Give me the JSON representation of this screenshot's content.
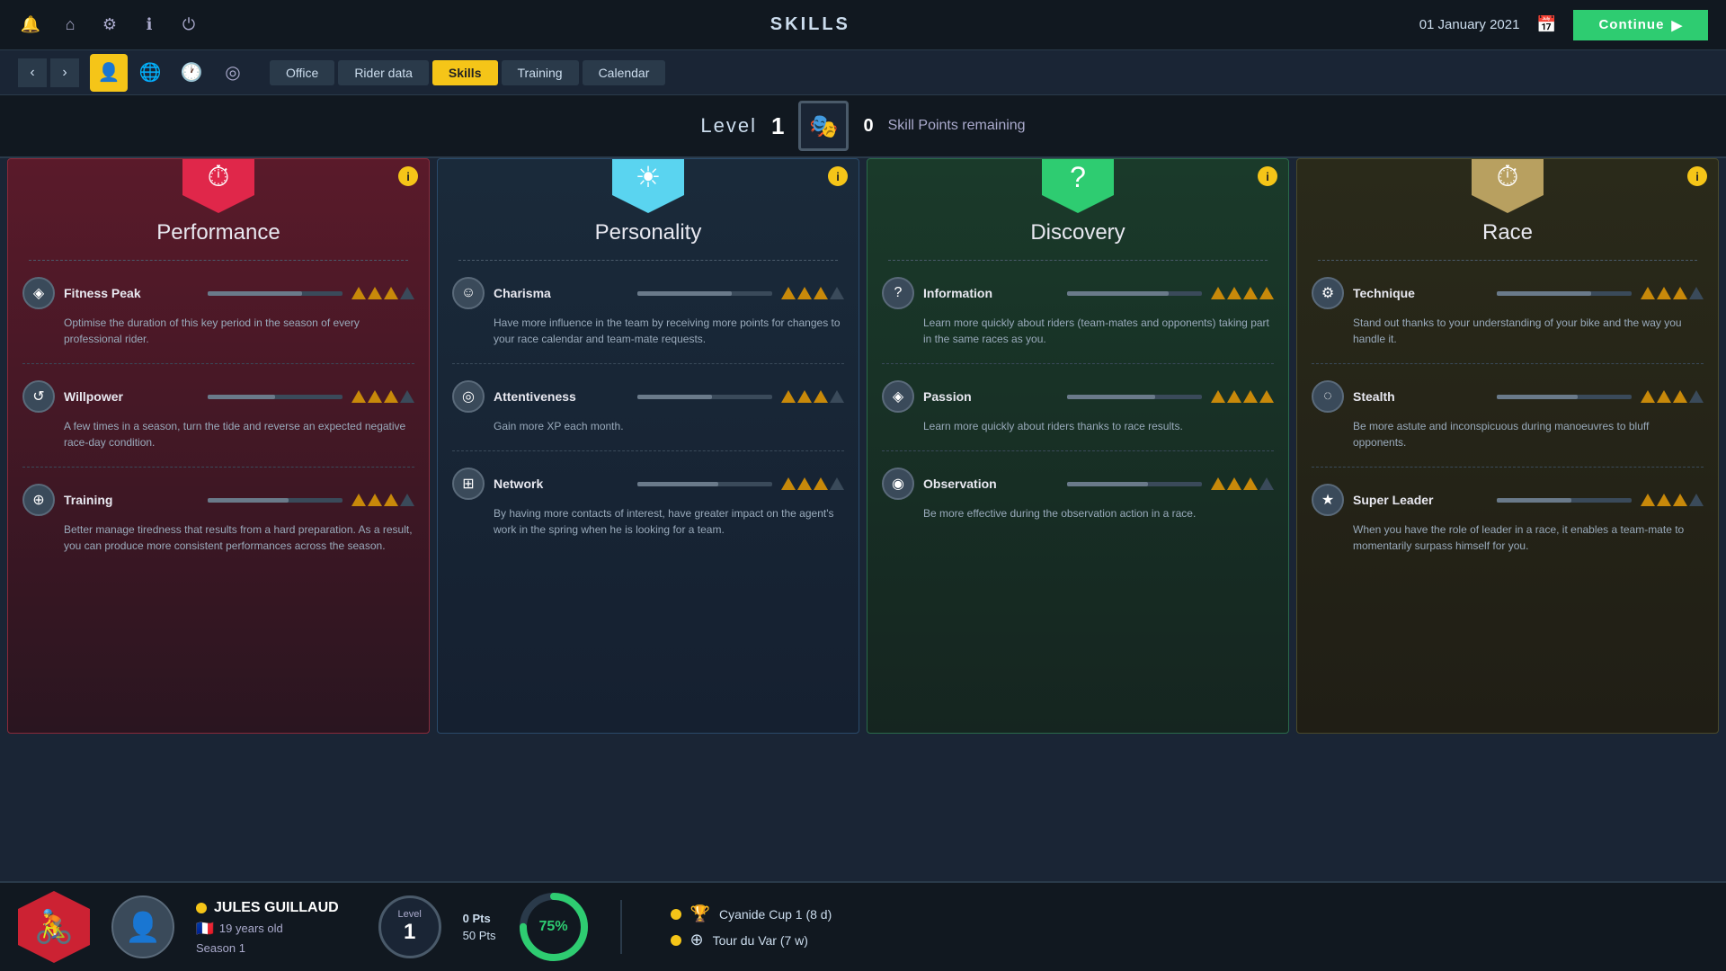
{
  "topbar": {
    "title": "SKILLS",
    "date": "01 January 2021",
    "continue_label": "Continue"
  },
  "nav": {
    "tabs": [
      {
        "label": "Office",
        "active": false
      },
      {
        "label": "Rider data",
        "active": false
      },
      {
        "label": "Skills",
        "active": true
      },
      {
        "label": "Training",
        "active": false
      },
      {
        "label": "Calendar",
        "active": false
      }
    ]
  },
  "level_bar": {
    "level_label": "Level",
    "level_num": "1",
    "skill_points": "0",
    "skill_points_label": "Skill Points remaining"
  },
  "cards": [
    {
      "id": "performance",
      "title": "Performance",
      "color_class": "card-performance",
      "hex_class": "hex-performance",
      "hex_icon": "⏱",
      "skills": [
        {
          "name": "Fitness Peak",
          "icon": "◈",
          "bar_fill": 70,
          "triangles": 3,
          "max_triangles": 4,
          "desc": "Optimise the duration of this key period in the season of every professional rider."
        },
        {
          "name": "Willpower",
          "icon": "↺",
          "bar_fill": 50,
          "triangles": 3,
          "max_triangles": 4,
          "desc": "A few times in a season, turn the tide and reverse an expected negative race-day condition."
        },
        {
          "name": "Training",
          "icon": "⊕",
          "bar_fill": 60,
          "triangles": 3,
          "max_triangles": 4,
          "desc": "Better manage tiredness that results from a hard preparation. As a result, you can produce more consistent performances across the season."
        }
      ]
    },
    {
      "id": "personality",
      "title": "Personality",
      "color_class": "card-personality",
      "hex_class": "hex-personality",
      "hex_icon": "☀",
      "skills": [
        {
          "name": "Charisma",
          "icon": "☺",
          "bar_fill": 70,
          "triangles": 3,
          "max_triangles": 4,
          "desc": "Have more influence in the team by receiving more points for changes to your race calendar and team-mate requests."
        },
        {
          "name": "Attentiveness",
          "icon": "◎",
          "bar_fill": 55,
          "triangles": 3,
          "max_triangles": 4,
          "desc": "Gain more XP each month."
        },
        {
          "name": "Network",
          "icon": "⊞",
          "bar_fill": 60,
          "triangles": 3,
          "max_triangles": 4,
          "desc": "By having more contacts of interest, have greater impact on the agent's work in the spring when he is looking for a team."
        }
      ]
    },
    {
      "id": "discovery",
      "title": "Discovery",
      "color_class": "card-discovery",
      "hex_class": "hex-discovery",
      "hex_icon": "?",
      "skills": [
        {
          "name": "Information",
          "icon": "?",
          "bar_fill": 75,
          "triangles": 4,
          "max_triangles": 4,
          "desc": "Learn more quickly about riders (team-mates and opponents) taking part in the same races as you."
        },
        {
          "name": "Passion",
          "icon": "◈",
          "bar_fill": 65,
          "triangles": 4,
          "max_triangles": 4,
          "desc": "Learn more quickly about riders thanks to race results."
        },
        {
          "name": "Observation",
          "icon": "◉",
          "bar_fill": 60,
          "triangles": 3,
          "max_triangles": 4,
          "desc": "Be more effective during the observation action in a race."
        }
      ]
    },
    {
      "id": "race",
      "title": "Race",
      "color_class": "card-race",
      "hex_class": "hex-race",
      "hex_icon": "⏱",
      "skills": [
        {
          "name": "Technique",
          "icon": "⚙",
          "bar_fill": 70,
          "triangles": 3,
          "max_triangles": 4,
          "desc": "Stand out thanks to your understanding of your bike and the way you handle it."
        },
        {
          "name": "Stealth",
          "icon": "◌",
          "bar_fill": 60,
          "triangles": 3,
          "max_triangles": 4,
          "desc": "Be more astute and inconspicuous during manoeuvres to bluff opponents."
        },
        {
          "name": "Super Leader",
          "icon": "★",
          "bar_fill": 55,
          "triangles": 3,
          "max_triangles": 4,
          "desc": "When you have the role of leader in a race, it enables a team-mate to momentarily surpass himself for you."
        }
      ]
    }
  ],
  "bottom": {
    "rider_name": "JULES GUILLAUD",
    "rider_age": "19 years old",
    "rider_season": "Season 1",
    "level_label": "Level",
    "level_num": "1",
    "pts_current": "0 Pts",
    "pts_total": "50 Pts",
    "progress_pct": "75%",
    "races": [
      {
        "icon": "🏆",
        "name": "Cyanide Cup 1 (8 d)"
      },
      {
        "icon": "⊕",
        "name": "Tour du Var (7 w)"
      }
    ]
  }
}
